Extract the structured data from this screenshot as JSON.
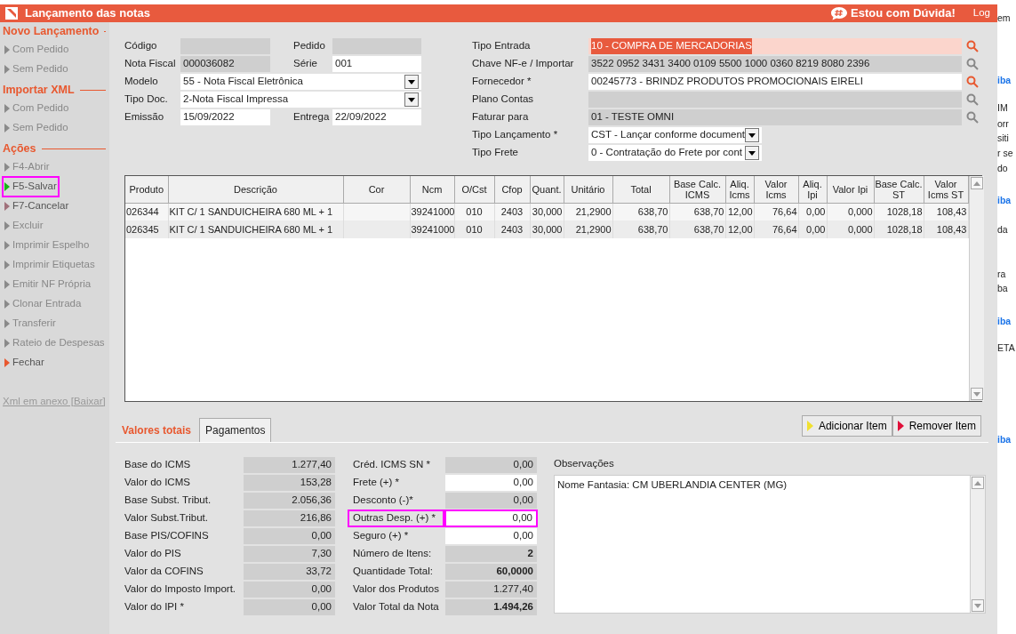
{
  "window": {
    "title": "Lançamento das notas",
    "help_button": "Estou com Dúvida!",
    "log_link": "Log"
  },
  "sidebar": {
    "sections": [
      {
        "title": "Novo Lançamento",
        "items": [
          {
            "label": "Com Pedido",
            "disabled": true,
            "color": "#8a8a8a",
            "highlighted": false
          },
          {
            "label": "Sem Pedido",
            "disabled": true,
            "color": "#8a8a8a",
            "highlighted": false
          }
        ]
      },
      {
        "title": "Importar XML",
        "items": [
          {
            "label": "Com Pedido",
            "disabled": true,
            "color": "#8a8a8a",
            "highlighted": false
          },
          {
            "label": "Sem Pedido",
            "disabled": true,
            "color": "#8a8a8a",
            "highlighted": false
          }
        ]
      },
      {
        "title": "Ações",
        "items": [
          {
            "label": "F4-Abrir",
            "disabled": true,
            "color": "#8a8a8a",
            "highlighted": false
          },
          {
            "label": "F5-Salvar",
            "disabled": false,
            "color": "#19b319",
            "highlighted": true
          },
          {
            "label": "F7-Cancelar",
            "disabled": false,
            "color": "#a0707a",
            "highlighted": false
          },
          {
            "label": "Excluir",
            "disabled": true,
            "color": "#8a8a8a",
            "highlighted": false
          },
          {
            "label": "Imprimir Espelho",
            "disabled": true,
            "color": "#8a8a8a",
            "highlighted": false
          },
          {
            "label": "Imprimir Etiquetas",
            "disabled": true,
            "color": "#8a8a8a",
            "highlighted": false
          },
          {
            "label": "Emitir NF Própria",
            "disabled": true,
            "color": "#8a8a8a",
            "highlighted": false
          },
          {
            "label": "Clonar Entrada",
            "disabled": true,
            "color": "#8a8a8a",
            "highlighted": false
          },
          {
            "label": "Transferir",
            "disabled": true,
            "color": "#8a8a8a",
            "highlighted": false
          },
          {
            "label": "Rateio de Despesas",
            "disabled": true,
            "color": "#8a8a8a",
            "highlighted": false
          },
          {
            "label": "Fechar",
            "disabled": false,
            "color": "#e8582f",
            "highlighted": false
          }
        ]
      }
    ],
    "footer_link": "Xml em anexo [Baixar]"
  },
  "header_left": [
    {
      "label": "Código",
      "kind": "text",
      "readonly": true
    },
    {
      "label": "Pedido",
      "kind": "text",
      "readonly": true
    },
    {
      "label": "Nota Fiscal",
      "kind": "text",
      "readonly": true,
      "value": "000036082"
    },
    {
      "label": "Série",
      "kind": "text",
      "readonly": false,
      "value": "001"
    },
    {
      "label": "Modelo",
      "kind": "select",
      "readonly": false,
      "value": "55 - Nota Fiscal Eletrônica"
    },
    {
      "label": "Tipo Doc.",
      "kind": "select",
      "readonly": false,
      "value": "2-Nota Fiscal Impressa"
    },
    {
      "label": "Emissão",
      "kind": "text",
      "readonly": false,
      "value": "15/09/2022"
    },
    {
      "label": "Entrega",
      "kind": "text",
      "readonly": false,
      "value": "22/09/2022"
    }
  ],
  "header_right": [
    {
      "label": "Tipo Entrada",
      "kind": "lookup",
      "editable": true,
      "focused": true,
      "value": "10 - COMPRA DE MERCADORIAS"
    },
    {
      "label": "Chave NF-e / Importar",
      "kind": "lookup",
      "editable": false,
      "focused": false,
      "value": "3522 0952 3431 3400 0109 5500 1000 0360 8219 8080 2396"
    },
    {
      "label": "Fornecedor *",
      "kind": "lookup",
      "editable": true,
      "focused": false,
      "value": "00245773 - BRINDZ PRODUTOS PROMOCIONAIS EIRELI"
    },
    {
      "label": "Plano Contas",
      "kind": "lookup",
      "editable": false,
      "focused": false
    },
    {
      "label": "Faturar para",
      "kind": "lookup",
      "editable": false,
      "focused": false,
      "value": "01 - TESTE OMNI"
    },
    {
      "label": "Tipo Lançamento *",
      "kind": "select",
      "value": "CST - Lançar conforme document"
    },
    {
      "label": "Tipo Frete",
      "kind": "select",
      "value": "0 - Contratação do Frete por cont"
    }
  ],
  "items_table": {
    "columns": [
      "Produto",
      "Descrição",
      "Cor",
      "Ncm",
      "O/Cst",
      "Cfop",
      "Quant.",
      "Unitário",
      "Total",
      "Base Calc. ICMS",
      "Aliq. Icms",
      "Valor Icms",
      "Aliq. Ipi",
      "Valor Ipi",
      "Base Calc. ST",
      "Valor Icms ST"
    ],
    "rows": [
      [
        "026344",
        "KIT C/ 1 SANDUICHEIRA 680 ML + 1",
        "",
        "39241000",
        "010",
        "2403",
        "30,000",
        "21,2900",
        "638,70",
        "638,70",
        "12,00",
        "76,64",
        "0,00",
        "0,000",
        "1028,18",
        "108,43"
      ],
      [
        "026345",
        "KIT C/ 1 SANDUICHEIRA 680 ML + 1",
        "",
        "39241000",
        "010",
        "2403",
        "30,000",
        "21,2900",
        "638,70",
        "638,70",
        "12,00",
        "76,64",
        "0,00",
        "0,000",
        "1028,18",
        "108,43"
      ]
    ]
  },
  "bottom_tabs": [
    {
      "label": "Valores totais",
      "selected": true
    },
    {
      "label": "Pagamentos",
      "selected": false
    }
  ],
  "item_buttons": [
    {
      "label": "Adicionar Item",
      "color": "#f0e030"
    },
    {
      "label": "Remover Item",
      "color": "#e0103a"
    }
  ],
  "totals_left": [
    {
      "label": "Base do ICMS",
      "value": "1.277,40",
      "editable": false,
      "bold": false,
      "highlighted": false
    },
    {
      "label": "Valor do ICMS",
      "value": "153,28",
      "editable": false,
      "bold": false,
      "highlighted": false
    },
    {
      "label": "Base Subst. Tribut.",
      "value": "2.056,36",
      "editable": false,
      "bold": false,
      "highlighted": false
    },
    {
      "label": "Valor Subst.Tribut.",
      "value": "216,86",
      "editable": false,
      "bold": false,
      "highlighted": false
    },
    {
      "label": "Base PIS/COFINS",
      "value": "0,00",
      "editable": false,
      "bold": false,
      "highlighted": false
    },
    {
      "label": "Valor do PIS",
      "value": "7,30",
      "editable": false,
      "bold": false,
      "highlighted": false
    },
    {
      "label": "Valor da COFINS",
      "value": "33,72",
      "editable": false,
      "bold": false,
      "highlighted": false
    },
    {
      "label": "Valor do Imposto Import.",
      "value": "0,00",
      "editable": false,
      "bold": false,
      "highlighted": false
    },
    {
      "label": "Valor do IPI *",
      "value": "0,00",
      "editable": false,
      "bold": false,
      "highlighted": false
    }
  ],
  "totals_right": [
    {
      "label": "Créd. ICMS SN *",
      "value": "0,00",
      "editable": false,
      "bold": false,
      "highlighted": false
    },
    {
      "label": "Frete (+) *",
      "value": "0,00",
      "editable": true,
      "bold": false,
      "highlighted": false
    },
    {
      "label": "Desconto (-)*",
      "value": "0,00",
      "editable": false,
      "bold": false,
      "highlighted": false
    },
    {
      "label": "Outras Desp. (+) *",
      "value": "0,00",
      "editable": true,
      "bold": false,
      "highlighted": true
    },
    {
      "label": "Seguro (+) *",
      "value": "0,00",
      "editable": true,
      "bold": false,
      "highlighted": false
    },
    {
      "label": "Número de Itens:",
      "value": "2",
      "editable": false,
      "bold": true,
      "highlighted": false
    },
    {
      "label": "Quantidade Total:",
      "value": "60,0000",
      "editable": false,
      "bold": true,
      "highlighted": false
    },
    {
      "label": "Valor dos Produtos",
      "value": "1.277,40",
      "editable": false,
      "bold": false,
      "highlighted": false
    },
    {
      "label": "Valor Total da Nota",
      "value": "1.494,26",
      "editable": false,
      "bold": true,
      "highlighted": false
    }
  ],
  "observations": {
    "label": "Observações",
    "value": "Nome Fantasia: CM UBERLANDIA CENTER (MG)"
  },
  "background_page": [
    {
      "text": "em",
      "kind": "text"
    },
    {
      "text": "iba",
      "kind": "link"
    },
    {
      "text": "IM",
      "kind": "text"
    },
    {
      "text": "orr",
      "kind": "text"
    },
    {
      "text": "siti",
      "kind": "text"
    },
    {
      "text": "r se",
      "kind": "text"
    },
    {
      "text": "do",
      "kind": "text"
    },
    {
      "text": "iba",
      "kind": "link"
    },
    {
      "text": "da",
      "kind": "text"
    },
    {
      "text": "ra",
      "kind": "text"
    },
    {
      "text": "ba",
      "kind": "text"
    },
    {
      "text": "iba",
      "kind": "link"
    },
    {
      "text": "ETA",
      "kind": "text"
    },
    {
      "text": "iba",
      "kind": "link"
    }
  ]
}
